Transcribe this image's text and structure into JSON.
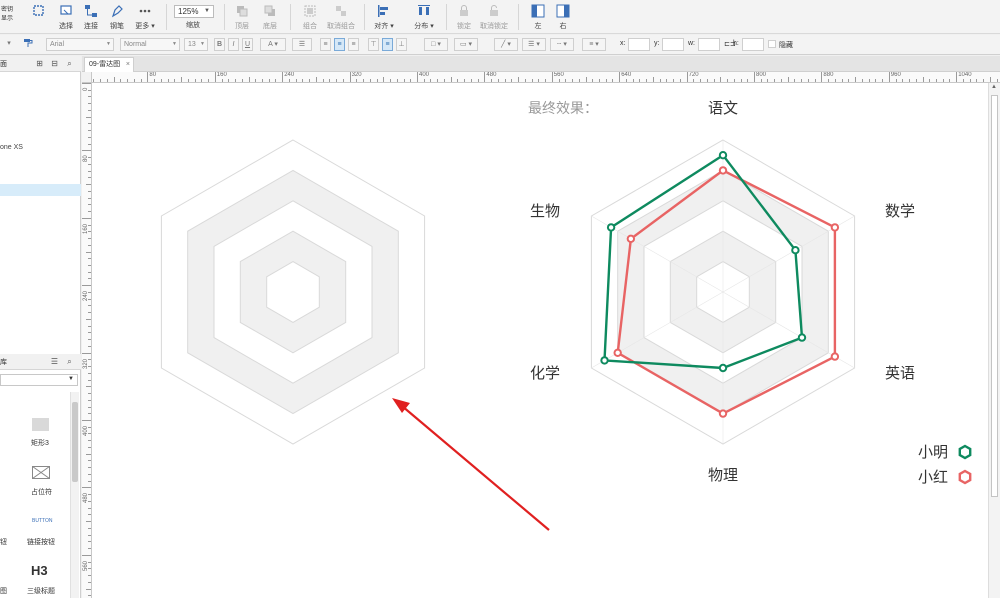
{
  "toolbar": {
    "top_left_label": "密钥",
    "top_left_label2": "显示",
    "items": [
      {
        "id": "select",
        "label": "选择"
      },
      {
        "id": "connect",
        "label": "连接"
      },
      {
        "id": "pen",
        "label": "钢笔"
      },
      {
        "id": "more",
        "label": "更多 ▾"
      },
      {
        "id": "zoom",
        "label": "缩放"
      },
      {
        "id": "top",
        "label": "顶层"
      },
      {
        "id": "bottom",
        "label": "底层"
      },
      {
        "id": "group",
        "label": "组合"
      },
      {
        "id": "ungroup",
        "label": "取消组合"
      },
      {
        "id": "align",
        "label": "对齐 ▾"
      },
      {
        "id": "distribute",
        "label": "分布 ▾"
      },
      {
        "id": "lock",
        "label": "锁定"
      },
      {
        "id": "unlock",
        "label": "取消锁定"
      },
      {
        "id": "left",
        "label": "左"
      },
      {
        "id": "right",
        "label": "右"
      }
    ],
    "zoom_value": "125%"
  },
  "format_bar": {
    "font_family": "Arial",
    "font_style": "Normal",
    "font_size": "13",
    "x_label": "x:",
    "y_label": "y:",
    "w_label": "w:",
    "h_label": "h:",
    "hidden_label": "隐藏"
  },
  "left_panel": {
    "pages_title": "面",
    "pages": [
      {
        "label": ""
      },
      {
        "label": "one XS"
      },
      {
        "label": ""
      }
    ],
    "library_title": "库",
    "widgets": [
      {
        "label": "矩形3"
      },
      {
        "label": "占位符"
      },
      {
        "label": "BUTTON"
      },
      {
        "label": "钮"
      },
      {
        "label": "链接按钮"
      },
      {
        "label": "H3"
      },
      {
        "label": "图"
      },
      {
        "label": "三级标题"
      }
    ]
  },
  "tabs": [
    {
      "label": "09-雷达图",
      "close": "×"
    }
  ],
  "ruler": {
    "h_ticks": [
      "0",
      "80",
      "160",
      "240",
      "320",
      "400",
      "480",
      "560",
      "640",
      "720",
      "800",
      "880",
      "960",
      "1040"
    ],
    "v_ticks": [
      "0",
      "80",
      "160",
      "240",
      "320",
      "400",
      "480",
      "560"
    ]
  },
  "canvas": {
    "result_title": "最终效果：",
    "axis_labels": [
      "语文",
      "数学",
      "英语",
      "物理",
      "化学",
      "生物"
    ],
    "legend": [
      {
        "name": "小明",
        "color": "#0e8a5f"
      },
      {
        "name": "小红",
        "color": "#e86464"
      }
    ]
  },
  "chart_data": {
    "type": "radar",
    "axes": [
      "语文",
      "数学",
      "英语",
      "物理",
      "化学",
      "生物"
    ],
    "rings": 5,
    "series": [
      {
        "name": "小明",
        "color": "#0e8a5f",
        "values": [
          0.9,
          0.55,
          0.6,
          0.5,
          0.9,
          0.85
        ]
      },
      {
        "name": "小红",
        "color": "#e86464",
        "values": [
          0.8,
          0.85,
          0.85,
          0.8,
          0.8,
          0.7
        ]
      }
    ]
  },
  "colors": {
    "ring_fill": "#f0f0f0",
    "ring_stroke": "#d9d9d9",
    "selection": "#d7ecfa",
    "arrow": "#e02020"
  }
}
